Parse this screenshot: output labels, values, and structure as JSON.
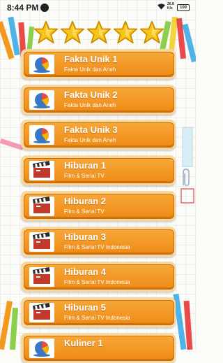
{
  "status_bar": {
    "time": "8:44 PM",
    "network_speed": "26.8\nK/s",
    "battery": "100",
    "app_icon": "pocket-icon",
    "wifi_icon": "wifi-icon"
  },
  "rating": {
    "stars": 5,
    "star_color": "#f5c518"
  },
  "menu": {
    "items": [
      {
        "title": "Fakta Unik 1",
        "subtitle": "Fakta Unik dan Aneh",
        "icon": "pie-chart-icon"
      },
      {
        "title": "Fakta Unik 2",
        "subtitle": "Fakta Unik dan Aneh",
        "icon": "pie-chart-icon"
      },
      {
        "title": "Fakta Unik 3",
        "subtitle": "Fakta Unik dan Aneh",
        "icon": "pie-chart-icon"
      },
      {
        "title": "Hiburan 1",
        "subtitle": "Film & Serial TV",
        "icon": "clapperboard-icon"
      },
      {
        "title": "Hiburan 2",
        "subtitle": "Film & Serial TV",
        "icon": "clapperboard-icon"
      },
      {
        "title": "Hiburan 3",
        "subtitle": "Film & Serial TV Indonesia",
        "icon": "clapperboard-icon"
      },
      {
        "title": "Hiburan 4",
        "subtitle": "Film & Serial TV Indonesia",
        "icon": "clapperboard-icon"
      },
      {
        "title": "Hiburan 5",
        "subtitle": "Film & Serial TV Indonesia",
        "icon": "clapperboard-icon"
      },
      {
        "title": "Kuliner 1",
        "subtitle": "",
        "icon": "pie-chart-icon"
      }
    ]
  },
  "colors": {
    "card_orange": "#ef9422",
    "card_border": "#f9d79c",
    "text": "#ffffff"
  }
}
